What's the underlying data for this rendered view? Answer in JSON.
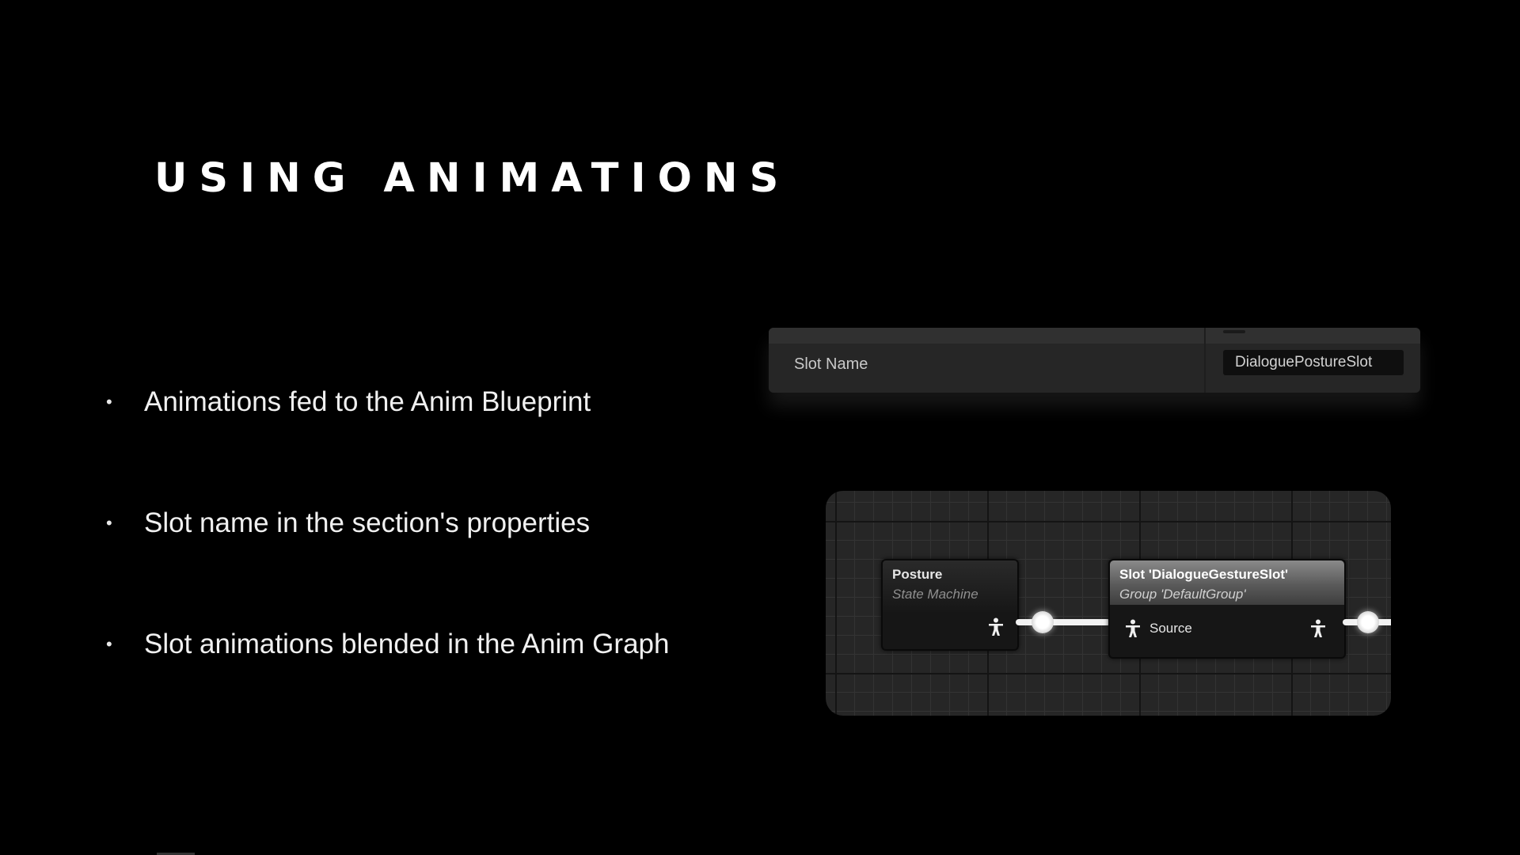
{
  "slide": {
    "title": "USING ANIMATIONS",
    "bullet_glyph": "•",
    "bullets": [
      "Animations fed to the Anim Blueprint",
      "Slot name in the section's properties",
      "Slot animations blended in the Anim Graph"
    ]
  },
  "property_panel": {
    "label": "Slot Name",
    "value": "DialoguePostureSlot"
  },
  "anim_graph": {
    "posture_node": {
      "title": "Posture",
      "subtitle": "State Machine",
      "output_icon": "pose-icon"
    },
    "slot_node": {
      "title": "Slot 'DialogueGestureSlot'",
      "subtitle": "Group 'DefaultGroup'",
      "input_label": "Source",
      "input_icon": "pose-icon",
      "output_icon": "pose-icon"
    }
  },
  "colors": {
    "background": "#000000",
    "graph_background": "#262626",
    "wire": "#f2f2f2"
  }
}
